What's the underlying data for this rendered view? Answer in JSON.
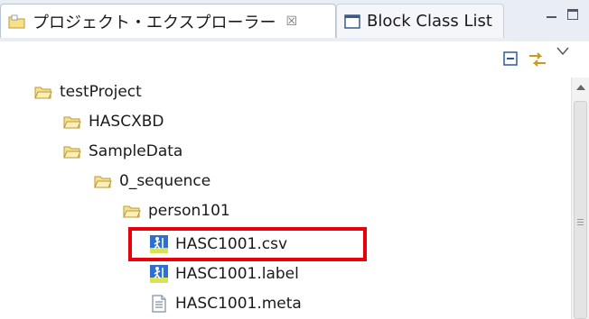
{
  "tabs": {
    "active": {
      "label": "プロジェクト・エクスプローラー",
      "close_glyph": "☒"
    },
    "inactive": {
      "label": "Block Class List"
    }
  },
  "tree": {
    "items": [
      {
        "label": "testProject",
        "icon": "project-folder-icon"
      },
      {
        "label": "HASCXBD",
        "icon": "folder-icon"
      },
      {
        "label": "SampleData",
        "icon": "folder-icon"
      },
      {
        "label": "0_sequence",
        "icon": "folder-icon"
      },
      {
        "label": "person101",
        "icon": "folder-icon"
      },
      {
        "label": "HASC1001.csv",
        "icon": "hasc-file-icon",
        "highlighted": true
      },
      {
        "label": "HASC1001.label",
        "icon": "hasc-file-icon"
      },
      {
        "label": "HASC1001.meta",
        "icon": "text-file-icon"
      }
    ]
  },
  "colors": {
    "highlight_border": "#e8000b",
    "tab_bar_bg": "#e9eef5",
    "folder_fill": "#f7e08a"
  }
}
